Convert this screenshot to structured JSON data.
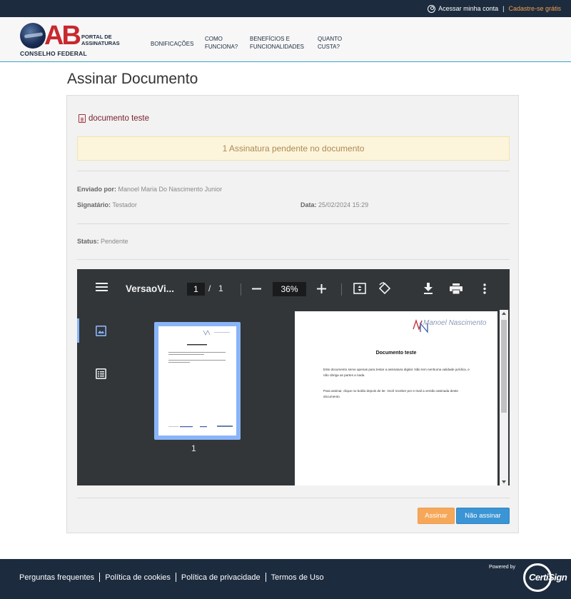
{
  "topbar": {
    "login_label": "Acessar minha conta",
    "separator": "|",
    "signup_label": "Cadastre-se grátis"
  },
  "header": {
    "logo_letters": "AB",
    "logo_caption": "CONSELHO FEDERAL",
    "logo_portal_line1": "PORTAL DE",
    "logo_portal_line2": "ASSINATURAS",
    "nav": [
      {
        "line1": "BONIFICAÇÕES",
        "line2": ""
      },
      {
        "line1": "COMO",
        "line2": "FUNCIONA?"
      },
      {
        "line1": "BENEFÍCIOS E",
        "line2": "FUNCIONALIDADES"
      },
      {
        "line1": "QUANTO",
        "line2": "CUSTA?"
      }
    ]
  },
  "page": {
    "title": "Assinar Documento"
  },
  "document": {
    "name": "documento teste",
    "alert": "1 Assinatura pendente no documento",
    "sent_by_label": "Enviado por:",
    "sent_by_value": "Manoel Maria Do Nascimento Junior",
    "signer_label": "Signatário:",
    "signer_value": "Testador",
    "date_label": "Data:",
    "date_value": "25/02/2024 15:29",
    "status_label": "Status:",
    "status_value": "Pendente"
  },
  "viewer": {
    "file_name": "VersaoVi...",
    "current_page": "1",
    "page_separator": "/",
    "total_pages": "1",
    "zoom": "36%",
    "thumbnail_number": "1",
    "page_title": "Documento teste",
    "page_logo_text": "Manoel Nascimento",
    "page_paragraph_1": "Este documento serve apenas para testar a assinatura digital. Não tem nenhuma validade jurídica, e não obriga as partes a nada.",
    "page_paragraph_2": "Para assinar, clique no botão depois de ler. Você receber por e-mail a versão assinada deste documento."
  },
  "actions": {
    "sign_label": "Assinar",
    "decline_label": "Não assinar"
  },
  "footer": {
    "links": [
      "Perguntas frequentes",
      "Política de cookies",
      "Política de privacidade",
      "Termos de Uso"
    ],
    "powered_by": "Powered by",
    "brand": "CertiSign"
  },
  "colors": {
    "topbar_bg": "#1c2b3e",
    "signup_accent": "#f5a04a",
    "brand_red": "#c8282e",
    "alert_bg": "#fcf5dc",
    "sign_button": "#f5a85a",
    "decline_button": "#3b94d4",
    "viewer_bg": "#323639",
    "thumb_highlight": "#8ab4f8"
  }
}
